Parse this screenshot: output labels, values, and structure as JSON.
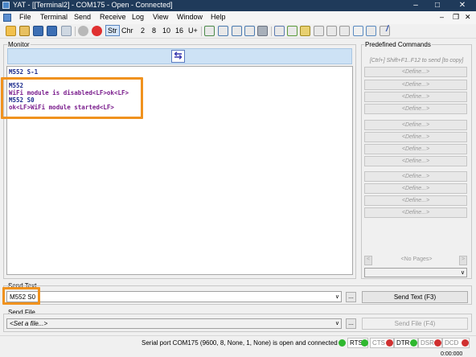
{
  "window": {
    "title": "YAT - [[Terminal2] - COM175 - Open - Connected]"
  },
  "menu": [
    "File",
    "Terminal",
    "Send",
    "Receive",
    "Log",
    "View",
    "Window",
    "Help"
  ],
  "toolbar": {
    "str": "Str",
    "chr": "Chr",
    "radix": [
      "2",
      "8",
      "10",
      "16",
      "U+"
    ]
  },
  "monitor": {
    "label": "Monitor",
    "lines": [
      {
        "text": "M552 S-1",
        "color": "#1a2a8c"
      },
      {
        "text": "M552",
        "color": "#1a2a8c"
      },
      {
        "text": "WiFi module is disabled<LF>ok<LF>",
        "color": "#7a1c8c"
      },
      {
        "text": "M552 S0",
        "color": "#1a2a8c"
      },
      {
        "text": "ok<LF>WiFi module started<LF>",
        "color": "#7a1c8c"
      }
    ]
  },
  "predefined": {
    "label": "Predefined Commands",
    "hint": "[Ctrl+] Shift+F1..F12 to send [to copy]",
    "define_label": "<Define...>",
    "pages_label": "<No Pages>"
  },
  "send_text": {
    "label": "Send Text",
    "value": "M552 S0",
    "browse": "...",
    "button": "Send Text (F3)"
  },
  "send_file": {
    "label": "Send File",
    "placeholder": "<Set a file...>",
    "browse": "...",
    "button": "Send File (F4)"
  },
  "status": {
    "message": "Serial port COM175 (9600, 8, None, 1, None) is open and connected",
    "signals": [
      "RTS",
      "CTS",
      "DTR",
      "DSR",
      "DCD"
    ],
    "time": "0:00:000",
    "colors": {
      "on": "#2fb82f",
      "off": "#d03030"
    }
  },
  "colors": {
    "highlight": "#f0921e",
    "monitor_header": "#cde2f5"
  }
}
